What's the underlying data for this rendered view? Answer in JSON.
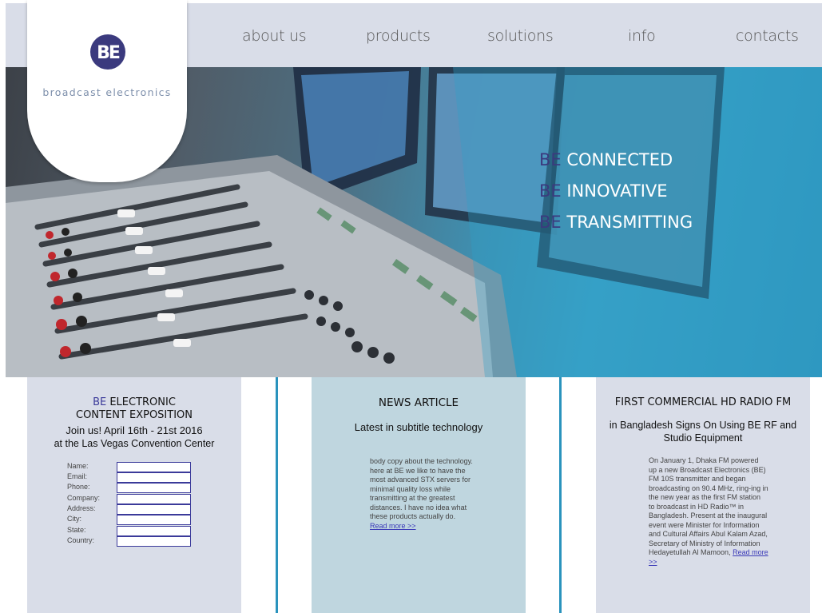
{
  "nav": {
    "items": [
      "about us",
      "products",
      "solutions",
      "info",
      "contacts"
    ]
  },
  "logo": {
    "mark": "BE",
    "text": "broadcast electronics"
  },
  "hero": {
    "taglines": [
      {
        "prefix": "BE",
        "text": " CONNECTED"
      },
      {
        "prefix": "BE",
        "text": " INNOVATIVE"
      },
      {
        "prefix": "BE",
        "text": " TRANSMITTING"
      }
    ]
  },
  "expo": {
    "title_prefix": "BE",
    "title_rest": " ELECTRONIC",
    "title_line2": "CONTENT EXPOSITION",
    "line1": "Join us! April 16th - 21st 2016",
    "line2": "at the Las Vegas Convention Center",
    "fields": [
      "Name:",
      "Email:",
      "Phone:",
      "Company:",
      "Address:",
      "City:",
      "State:",
      "Country:"
    ]
  },
  "news": {
    "title": "NEWS ARTICLE",
    "subtitle": "Latest in subtitle technology",
    "body": "body copy about the technology. here at BE we like to have the most advanced STX servers for minimal quality loss while transmitting at the greatest distances.  I have no idea what these products actually do.",
    "read_more": "Read more >>"
  },
  "radio": {
    "title": "FIRST COMMERCIAL HD RADIO FM",
    "subtitle": "in Bangladesh Signs On Using BE RF and Studio Equipment",
    "body": "On January 1, Dhaka FM powered up a new Broadcast Electronics (BE) FM 10S transmitter and began broadcasting on 90.4 MHz, ring-ing in the new year as the first FM station to broadcast in HD Radio™ in Bangladesh. Present at the inaugural event were Minister for Information and Cultural Affairs Abul Kalam Azad, Secretary of Ministry of Information Hedayetullah Al Mamoon,",
    "read_more": "Read more >>"
  },
  "colors": {
    "accent_blue": "#2a93bd",
    "brand_purple": "#3b3a7e",
    "panel_grey": "#d9dde8",
    "panel_teal": "#bfd6df"
  }
}
